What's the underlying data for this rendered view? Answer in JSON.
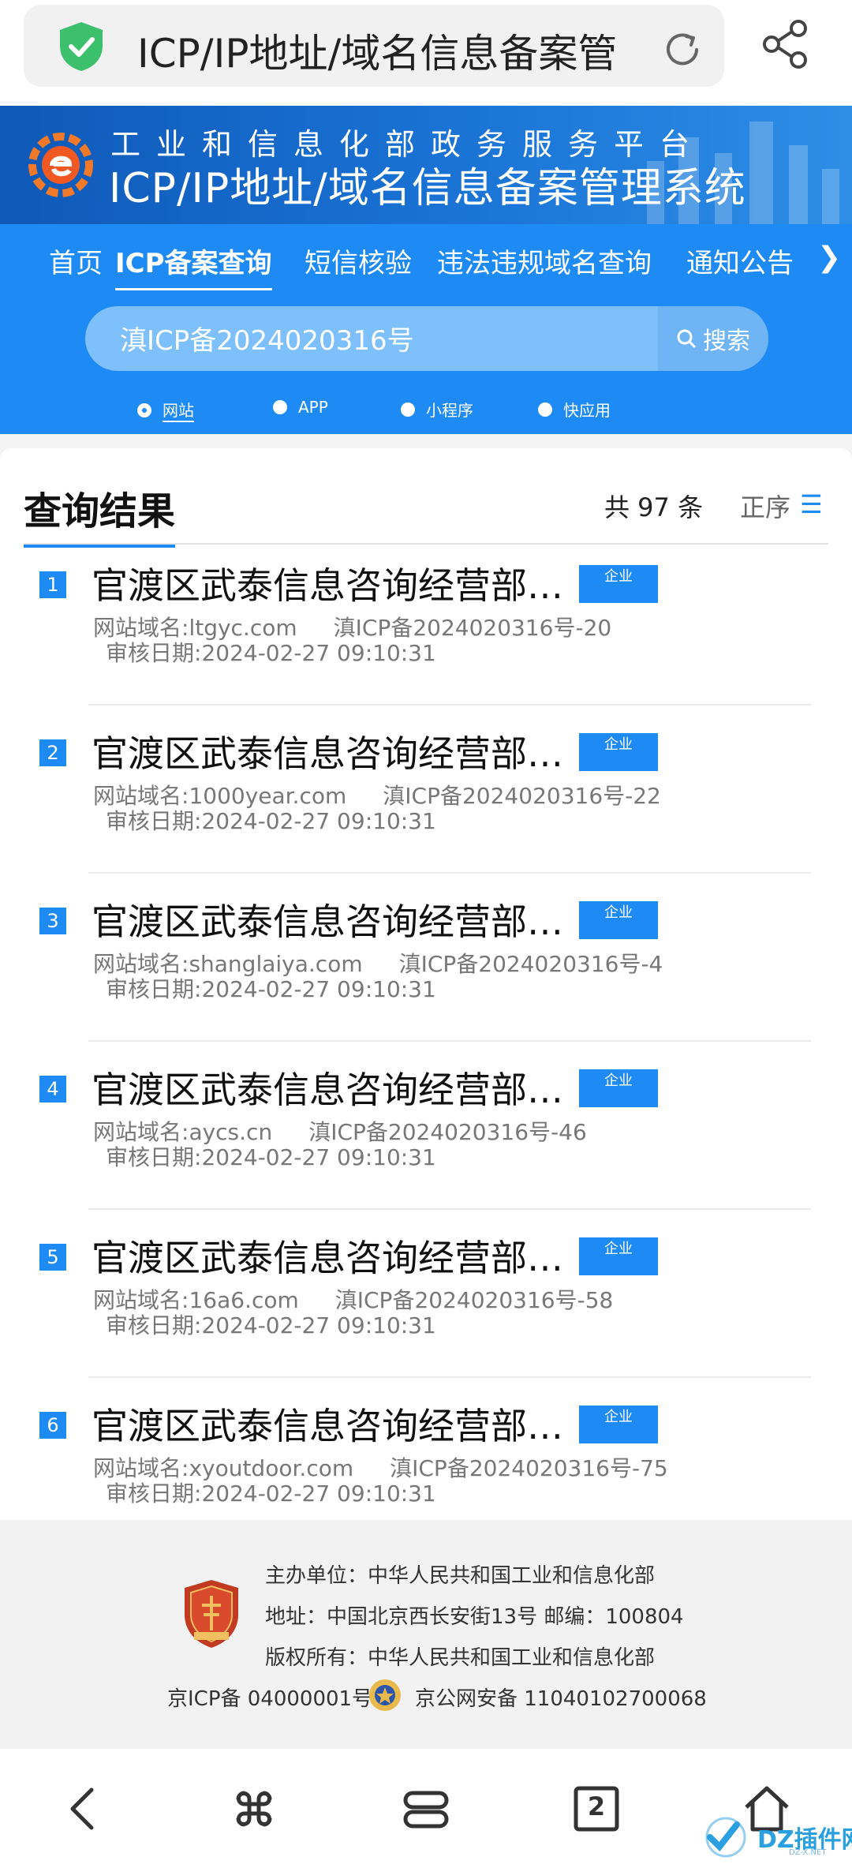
{
  "browser": {
    "url_title": "ICP/IP地址/域名信息备案管"
  },
  "header": {
    "org_title": "工业和信息化部政务服务平台",
    "system_title": "ICP/IP地址/域名信息备案管理系统"
  },
  "nav": {
    "items": [
      "首页",
      "ICP备案查询",
      "短信核验",
      "违法违规域名查询",
      "通知公告"
    ],
    "active_index": 1,
    "more": "❯"
  },
  "search": {
    "value": "滇ICP备2024020316号",
    "button_label": "搜索"
  },
  "types": {
    "options": [
      "网站",
      "APP",
      "小程序",
      "快应用"
    ],
    "selected": "网站"
  },
  "results": {
    "title": "查询结果",
    "count_text": "共 97 条",
    "order_label": "正序",
    "order_icon": "☰",
    "items": [
      {
        "index": "1",
        "name": "官渡区武泰信息咨询经营部…",
        "tag": "企业",
        "domain_label": "网站域名:",
        "domain": "ltgyc.com",
        "license": "滇ICP备2024020316号-20",
        "date_label": "审核日期:",
        "date": "2024-02-27 09:10:31"
      },
      {
        "index": "2",
        "name": "官渡区武泰信息咨询经营部…",
        "tag": "企业",
        "domain_label": "网站域名:",
        "domain": "1000year.com",
        "license": "滇ICP备2024020316号-22",
        "date_label": "审核日期:",
        "date": "2024-02-27 09:10:31"
      },
      {
        "index": "3",
        "name": "官渡区武泰信息咨询经营部…",
        "tag": "企业",
        "domain_label": "网站域名:",
        "domain": "shanglaiya.com",
        "license": "滇ICP备2024020316号-4",
        "date_label": "审核日期:",
        "date": "2024-02-27 09:10:31"
      },
      {
        "index": "4",
        "name": "官渡区武泰信息咨询经营部…",
        "tag": "企业",
        "domain_label": "网站域名:",
        "domain": "aycs.cn",
        "license": "滇ICP备2024020316号-46",
        "date_label": "审核日期:",
        "date": "2024-02-27 09:10:31"
      },
      {
        "index": "5",
        "name": "官渡区武泰信息咨询经营部…",
        "tag": "企业",
        "domain_label": "网站域名:",
        "domain": "16a6.com",
        "license": "滇ICP备2024020316号-58",
        "date_label": "审核日期:",
        "date": "2024-02-27 09:10:31"
      },
      {
        "index": "6",
        "name": "官渡区武泰信息咨询经营部…",
        "tag": "企业",
        "domain_label": "网站域名:",
        "domain": "xyoutdoor.com",
        "license": "滇ICP备2024020316号-75",
        "date_label": "审核日期:",
        "date": "2024-02-27 09:10:31"
      }
    ]
  },
  "footer": {
    "host": "主办单位：中华人民共和国工业和信息化部",
    "address": "地址：中国北京西长安街13号 邮编：100804",
    "copyright": "版权所有：中华人民共和国工业和信息化部",
    "icp": "京ICP备 04000001号",
    "police": "京公网安备 11040102700068"
  },
  "bottom_bar": {
    "icons": [
      "back-icon",
      "apps-icon",
      "menu-icon",
      "tabs-icon",
      "home-icon"
    ],
    "tab_count": "2"
  },
  "watermark": {
    "text": "DZ插件网",
    "sub": "DZ-X.NET"
  },
  "colors": {
    "accent": "#1e8af3",
    "banner": "#1a74d6",
    "shield": "#3cc06b"
  }
}
